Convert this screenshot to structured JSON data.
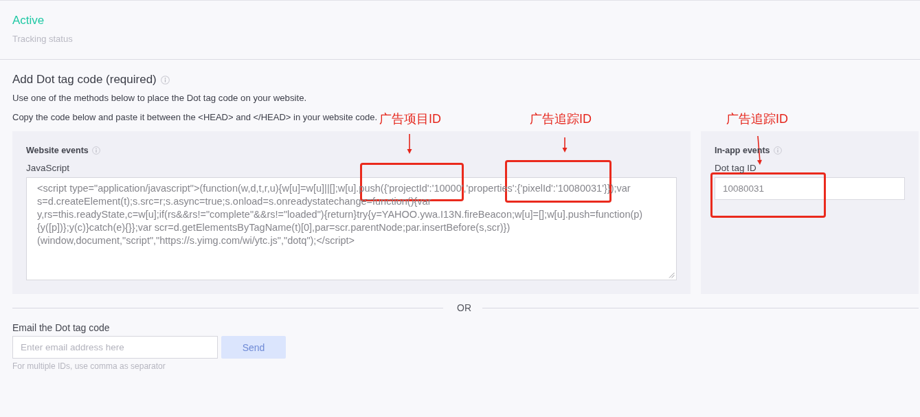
{
  "tracking": {
    "active": true,
    "value": "Active",
    "label": "Tracking status"
  },
  "setup": {
    "title": "Add Dot tag code (required)",
    "intro": "Use one of the methods below to place the Dot tag code on your website.",
    "instruction": "Copy the code below and paste it between the <HEAD> and </HEAD> in your website code."
  },
  "website_events": {
    "title": "Website events",
    "code_label": "JavaScript",
    "code_lines": [
      "<script type=\"application/javascript\">(function(w,d,t,r,u){w[u]=w[u]||[];w[u].push({'projectId':'10000','properties':{'pixelId':'10080031'}});var",
      "s=d.createElement(t);s.src=r;s.async=true;s.onload=s.onreadystatechange=function(){var",
      "y,rs=this.readyState,c=w[u];if(rs&&rs!=\"complete\"&&rs!=\"loaded\"){return}try{y=YAHOO.ywa.I13N.fireBeacon;w[u]=[];w[u].push=function(p)",
      "{y([p])};y(c)}catch(e){}};var scr=d.getElementsByTagName(t)[0],par=scr.parentNode;par.insertBefore(s,scr)})",
      "(window,document,\"script\",\"https://s.yimg.com/wi/ytc.js\",\"dotq\");</script>"
    ]
  },
  "in_app_events": {
    "title": "In-app events",
    "field_label": "Dot tag ID",
    "field_value": "10080031"
  },
  "divider": {
    "label": "OR"
  },
  "email": {
    "label": "Email the Dot tag code",
    "placeholder": "Enter email address here",
    "button": {
      "label": "Send",
      "disabled": true
    },
    "hint": "For multiple IDs, use comma as separator"
  },
  "annotations": [
    {
      "label": "广告项目ID"
    },
    {
      "label": "广告追踪ID"
    },
    {
      "label": "广告追踪ID"
    }
  ]
}
